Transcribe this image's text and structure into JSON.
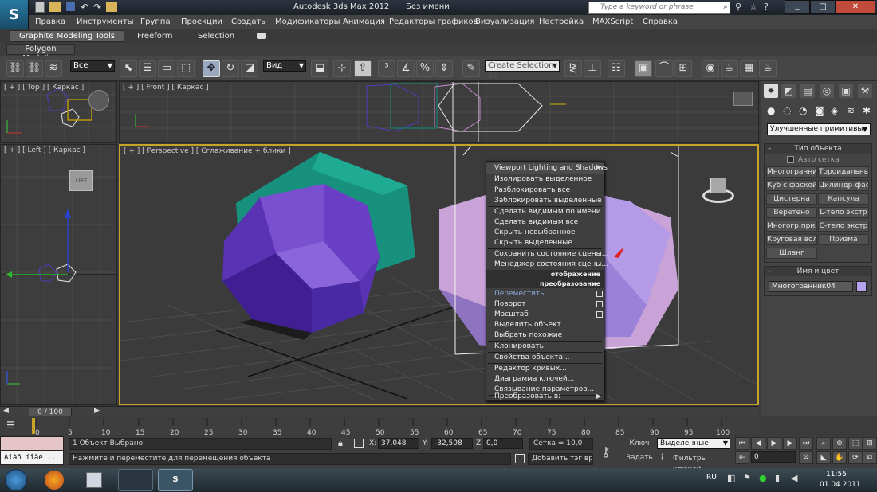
{
  "title_bar": {
    "app_title": "Autodesk 3ds Max  2012",
    "doc_title": "Без имени",
    "search_placeholder": "Type a keyword or phrase"
  },
  "menu": [
    "Правка",
    "Инструменты",
    "Группа",
    "Проекции",
    "Создать",
    "Модификаторы",
    "Анимация",
    "Редакторы графиков",
    "Визуализация",
    "Настройка",
    "MAXScript",
    "Справка"
  ],
  "ribbon": {
    "tabs": [
      "Graphite Modeling Tools",
      "Freeform",
      "Selection"
    ],
    "panel": "Polygon Modeling"
  },
  "toolbar": {
    "filter": "Все",
    "ref_coord": "Вид",
    "selection_set_placeholder": "Create Selection Se"
  },
  "viewports": {
    "top": "[ + ] [ Top ] [ Каркас ]",
    "front": "[ + ] [ Front ] [ Каркас ]",
    "left": "[ + ] [ Left ] [ Каркас ]",
    "perspective": "[ + ] [ Perspective ] [ Сглаживание + блики ]"
  },
  "context_menu": {
    "top_items": [
      "Viewport Lighting and Shadows",
      "Изолировать выделенное",
      "Разблокировать все",
      "Заблокировать выделенные",
      "Сделать видимым по имени",
      "Сделать видимым все",
      "Скрыть невыбранное",
      "Скрыть выделенные",
      "Сохранить состояние сцены...",
      "Менеджер состояния сцены..."
    ],
    "header_display": "отображение",
    "header_transform": "преобразование",
    "bottom_items": [
      "Переместить",
      "Поворот",
      "Масштаб",
      "Выделить объект",
      "Выбрать похожие",
      "Клонировать",
      "Свойства объекта...",
      "Редактор кривых...",
      "Диаграмма ключей...",
      "Связывание параметров...",
      "Преобразовать в:"
    ]
  },
  "command_panel": {
    "category": "Улучшенные примитивы",
    "object_type_title": "Тип объекта",
    "autogrid": "Авто сетка",
    "buttons": [
      "Многогранник",
      "Тороидальный",
      "Куб с фаской",
      "Цилиндр-фаска",
      "Цистерна",
      "Капсула",
      "Веретено",
      "L-тело экстр",
      "Многогр.призма",
      "C-тело экстр",
      "Круговая волна",
      "Призма",
      "Шланг"
    ],
    "name_color_title": "Имя и цвет",
    "object_name": "Многогранник04",
    "object_color": "#b6a3f0"
  },
  "timeline": {
    "frame_label": "0 / 100",
    "ticks": [
      "0",
      "5",
      "10",
      "15",
      "20",
      "25",
      "30",
      "35",
      "40",
      "45",
      "50",
      "55",
      "60",
      "65",
      "70",
      "75",
      "80",
      "85",
      "90",
      "95",
      "100"
    ]
  },
  "status": {
    "maxscript_text": "Àîàö íîàé...",
    "selected": "1 Объект Выбрано",
    "prompt": "Нажмите и переместите для перемещения объекта",
    "x_value": "37,048",
    "y_value": "-32,508",
    "z_value": "0,0",
    "grid": "Сетка = 10,0",
    "add_tag": "Добавить тэг време",
    "key_label": "Ключ",
    "set_label": "Задать",
    "key_mode": "Выделенные",
    "key_filters": "Фильтры ключей",
    "frame_field": "0"
  },
  "taskbar": {
    "lang": "RU",
    "time": "11:55",
    "date": "01.04.2011"
  },
  "colors": {
    "accent_blue": "#1e5a9a",
    "selection_yellow": "#c8a32a",
    "teal_obj": "#1a9a85",
    "purple_obj": "#4a2d9e",
    "pink_obj": "#d2a9d6",
    "lavender_obj": "#b6a3f0"
  }
}
